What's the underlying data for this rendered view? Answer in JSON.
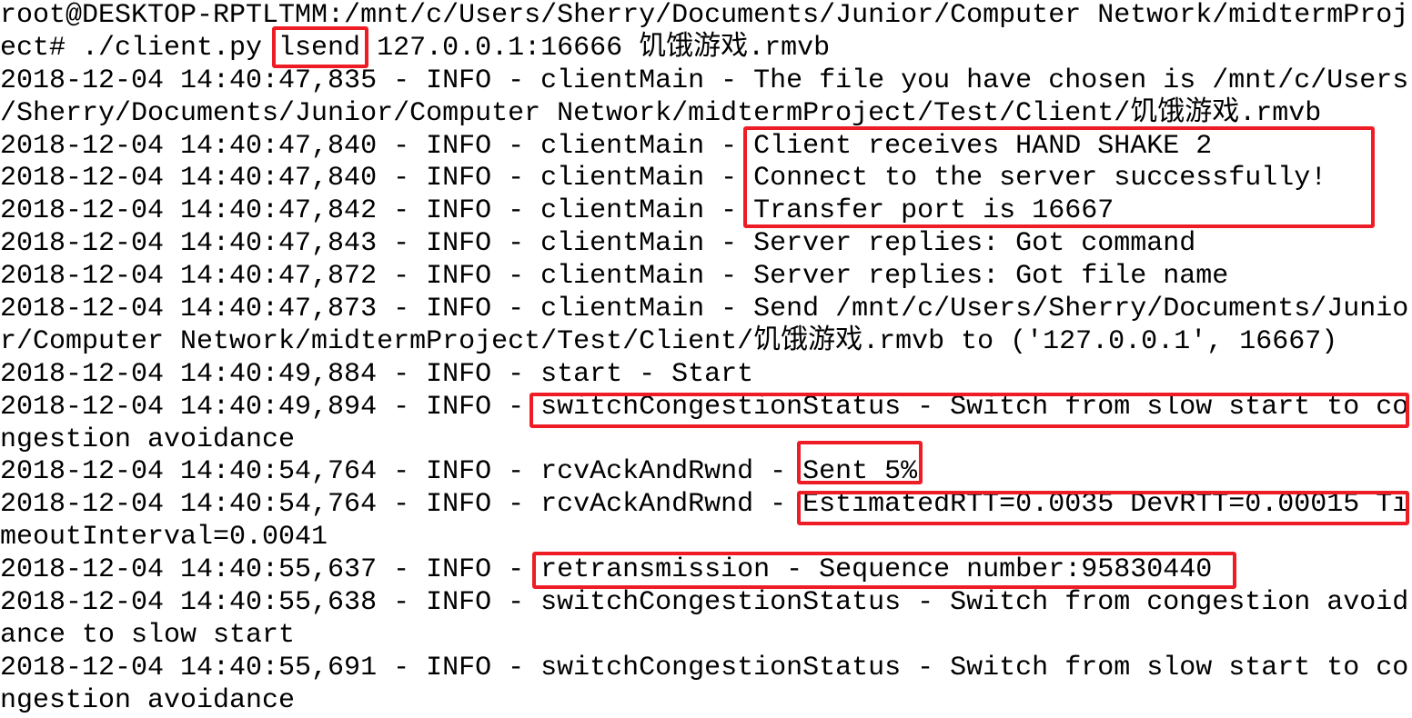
{
  "terminal": {
    "lines": [
      "root@DESKTOP-RPTLTMM:/mnt/c/Users/Sherry/Documents/Junior/Computer Network/midtermProj",
      "ect# ./client.py lsend 127.0.0.1:16666 饥饿游戏.rmvb",
      "2018-12-04 14:40:47,835 - INFO - clientMain - The file you have chosen is /mnt/c/Users",
      "/Sherry/Documents/Junior/Computer Network/midtermProject/Test/Client/饥饿游戏.rmvb",
      "2018-12-04 14:40:47,840 - INFO - clientMain - Client receives HAND SHAKE 2",
      "2018-12-04 14:40:47,840 - INFO - clientMain - Connect to the server successfully!",
      "2018-12-04 14:40:47,842 - INFO - clientMain - Transfer port is 16667",
      "2018-12-04 14:40:47,843 - INFO - clientMain - Server replies: Got command",
      "2018-12-04 14:40:47,872 - INFO - clientMain - Server replies: Got file name",
      "2018-12-04 14:40:47,873 - INFO - clientMain - Send /mnt/c/Users/Sherry/Documents/Junio",
      "r/Computer Network/midtermProject/Test/Client/饥饿游戏.rmvb to ('127.0.0.1', 16667)",
      "2018-12-04 14:40:49,884 - INFO - start - Start",
      "2018-12-04 14:40:49,894 - INFO - switchCongestionStatus - Switch from slow start to co",
      "ngestion avoidance",
      "2018-12-04 14:40:54,764 - INFO - rcvAckAndRwnd - Sent 5%",
      "2018-12-04 14:40:54,764 - INFO - rcvAckAndRwnd - EstimatedRTT=0.0035 DevRTT=0.00015 Ti",
      "meoutInterval=0.0041",
      "2018-12-04 14:40:55,637 - INFO - retransmission - Sequence number:95830440",
      "2018-12-04 14:40:55,638 - INFO - switchCongestionStatus - Switch from congestion avoid",
      "ance to slow start",
      "2018-12-04 14:40:55,691 - INFO - switchCongestionStatus - Switch from slow start to co",
      "ngestion avoidance"
    ]
  },
  "annotation_color": "#ee1c25"
}
